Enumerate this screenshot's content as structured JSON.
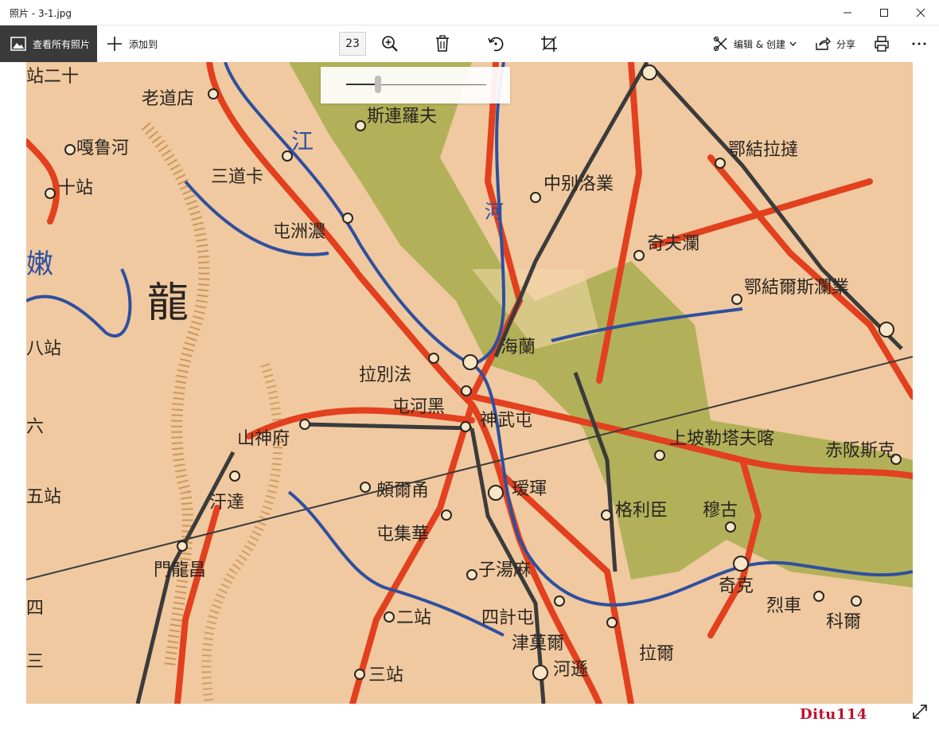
{
  "window": {
    "title": "照片 - 3-1.jpg"
  },
  "toolbar": {
    "see_all_label": "查看所有照片",
    "add_to_label": "添加到",
    "zoom_level": "23",
    "edit_create_label": "编辑 & 创建",
    "share_label": "分享"
  },
  "zoom_slider": {
    "fraction": 0.23
  },
  "map_labels": [
    "老道店",
    "嘎鲁河",
    "十站",
    "三道卡",
    "屯洲濃",
    "斯連羅夫",
    "中别洛業",
    "奇夫瀾",
    "鄂結拉撻",
    "鄂結爾斯瀾業",
    "拉別法",
    "海蘭",
    "屯河黑",
    "神武屯",
    "山神府",
    "汗達",
    "瑷琿",
    "頗爾甬",
    "格利臣",
    "穆古",
    "上坡勒塔夫喀",
    "赤阪斯克",
    "屯集華",
    "子湯麻",
    "四計屯",
    "二站",
    "津莫爾",
    "拉爾",
    "三站",
    "河遜",
    "奇克",
    "門龍昌",
    "科爾",
    "烈車",
    "龍",
    "江",
    "河",
    "嫩",
    "八站",
    "六",
    "五站",
    "四",
    "三",
    "站二十"
  ],
  "watermark": "Ditu114",
  "colors": {
    "map_background": "#f0c9a0",
    "railway_red": "#e2401e",
    "river_blue": "#2f4f9f",
    "marsh_green": "#a7ad4c",
    "dark_rail": "#3b3b3b"
  },
  "icons": {
    "see_all": "photos-icon",
    "add": "plus-icon",
    "zoom": "zoom-in-icon",
    "delete": "trash-icon",
    "rotate": "rotate-icon",
    "crop": "crop-icon",
    "edit": "edit-create-icon",
    "share": "share-icon",
    "print": "print-icon",
    "more": "more-icon",
    "expand": "expand-icon"
  }
}
